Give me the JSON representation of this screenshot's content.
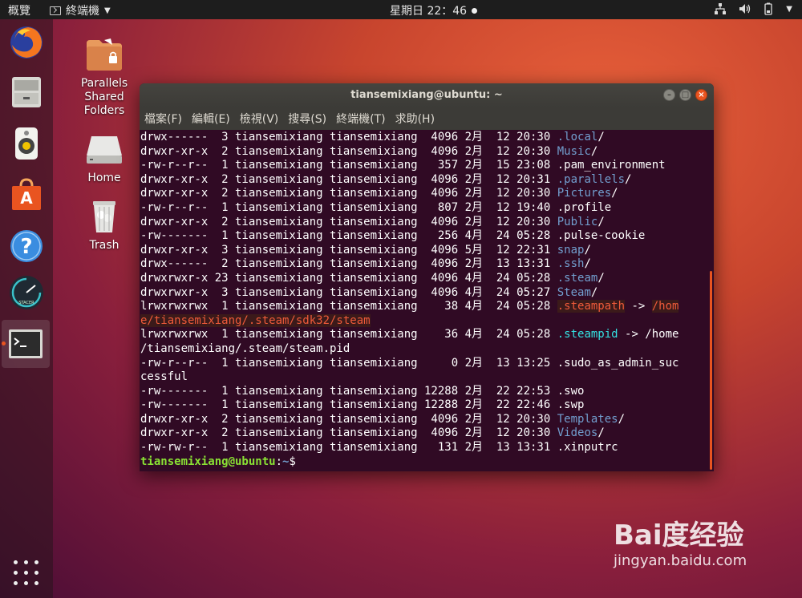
{
  "topbar": {
    "activities": "概覽",
    "app_name": "終端機",
    "clock": "星期日 22：46"
  },
  "desktop": {
    "icons": [
      {
        "label": "Parallels\nShared\nFolders"
      },
      {
        "label": "Home"
      },
      {
        "label": "Trash"
      }
    ]
  },
  "window": {
    "title": "tiansemixiang@ubuntu: ~",
    "menu": [
      "檔案(F)",
      "編輯(E)",
      "檢視(V)",
      "搜尋(S)",
      "終端機(T)",
      "求助(H)"
    ],
    "lines": [
      [
        {
          "t": "drwx------  3 tiansemixiang tiansemixiang  4096 2月  12 20:30 "
        },
        {
          "t": ".local",
          "c": "dir"
        },
        {
          "t": "/"
        }
      ],
      [
        {
          "t": "drwxr-xr-x  2 tiansemixiang tiansemixiang  4096 2月  12 20:30 "
        },
        {
          "t": "Music",
          "c": "dir"
        },
        {
          "t": "/"
        }
      ],
      [
        {
          "t": "-rw-r--r--  1 tiansemixiang tiansemixiang   357 2月  15 23:08 .pam_environment"
        }
      ],
      [
        {
          "t": "drwxr-xr-x  2 tiansemixiang tiansemixiang  4096 2月  12 20:31 "
        },
        {
          "t": ".parallels",
          "c": "dir"
        },
        {
          "t": "/"
        }
      ],
      [
        {
          "t": "drwxr-xr-x  2 tiansemixiang tiansemixiang  4096 2月  12 20:30 "
        },
        {
          "t": "Pictures",
          "c": "dir"
        },
        {
          "t": "/"
        }
      ],
      [
        {
          "t": "-rw-r--r--  1 tiansemixiang tiansemixiang   807 2月  12 19:40 .profile"
        }
      ],
      [
        {
          "t": "drwxr-xr-x  2 tiansemixiang tiansemixiang  4096 2月  12 20:30 "
        },
        {
          "t": "Public",
          "c": "dir"
        },
        {
          "t": "/"
        }
      ],
      [
        {
          "t": "-rw-------  1 tiansemixiang tiansemixiang   256 4月  24 05:28 .pulse-cookie"
        }
      ],
      [
        {
          "t": "drwxr-xr-x  3 tiansemixiang tiansemixiang  4096 5月  12 22:31 "
        },
        {
          "t": "snap",
          "c": "dir"
        },
        {
          "t": "/"
        }
      ],
      [
        {
          "t": "drwx------  2 tiansemixiang tiansemixiang  4096 2月  13 13:31 "
        },
        {
          "t": ".ssh",
          "c": "dir"
        },
        {
          "t": "/"
        }
      ],
      [
        {
          "t": "drwxrwxr-x 23 tiansemixiang tiansemixiang  4096 4月  24 05:28 "
        },
        {
          "t": ".steam",
          "c": "dir"
        },
        {
          "t": "/"
        }
      ],
      [
        {
          "t": "drwxrwxr-x  3 tiansemixiang tiansemixiang  4096 4月  24 05:27 "
        },
        {
          "t": "Steam",
          "c": "dir"
        },
        {
          "t": "/"
        }
      ],
      [
        {
          "t": "lrwxrwxrwx  1 tiansemixiang tiansemixiang    38 4月  24 05:28 "
        },
        {
          "t": ".steampath",
          "c": "bk"
        },
        {
          "t": " -> "
        },
        {
          "t": "/hom",
          "c": "bk"
        }
      ],
      [
        {
          "t": "e/tiansemixiang/.steam/sdk32/steam",
          "c": "bk"
        }
      ],
      [
        {
          "t": "lrwxrwxrwx  1 tiansemixiang tiansemixiang    36 4月  24 05:28 "
        },
        {
          "t": ".steampid",
          "c": "link"
        },
        {
          "t": " -> /home"
        }
      ],
      [
        {
          "t": "/tiansemixiang/.steam/steam.pid"
        }
      ],
      [
        {
          "t": "-rw-r--r--  1 tiansemixiang tiansemixiang     0 2月  13 13:25 .sudo_as_admin_suc"
        }
      ],
      [
        {
          "t": "cessful"
        }
      ],
      [
        {
          "t": "-rw-------  1 tiansemixiang tiansemixiang 12288 2月  22 22:53 .swo"
        }
      ],
      [
        {
          "t": "-rw-------  1 tiansemixiang tiansemixiang 12288 2月  22 22:46 .swp"
        }
      ],
      [
        {
          "t": "drwxr-xr-x  2 tiansemixiang tiansemixiang  4096 2月  12 20:30 "
        },
        {
          "t": "Templates",
          "c": "dir"
        },
        {
          "t": "/"
        }
      ],
      [
        {
          "t": "drwxr-xr-x  2 tiansemixiang tiansemixiang  4096 2月  12 20:30 "
        },
        {
          "t": "Videos",
          "c": "dir"
        },
        {
          "t": "/"
        }
      ],
      [
        {
          "t": "-rw-rw-r--  1 tiansemixiang tiansemixiang   131 2月  13 13:31 .xinputrc"
        }
      ]
    ],
    "prompt": {
      "user": "tiansemixiang@ubuntu",
      "sep": ":",
      "path": "~",
      "symbol": "$"
    }
  },
  "watermark": {
    "brand": "Bai度经验",
    "url": "jingyan.baidu.com"
  },
  "colors": {
    "accent": "#e95420",
    "terminal_bg": "#300a24",
    "dir": "#729fcf",
    "prompt_user": "#8ae234"
  }
}
